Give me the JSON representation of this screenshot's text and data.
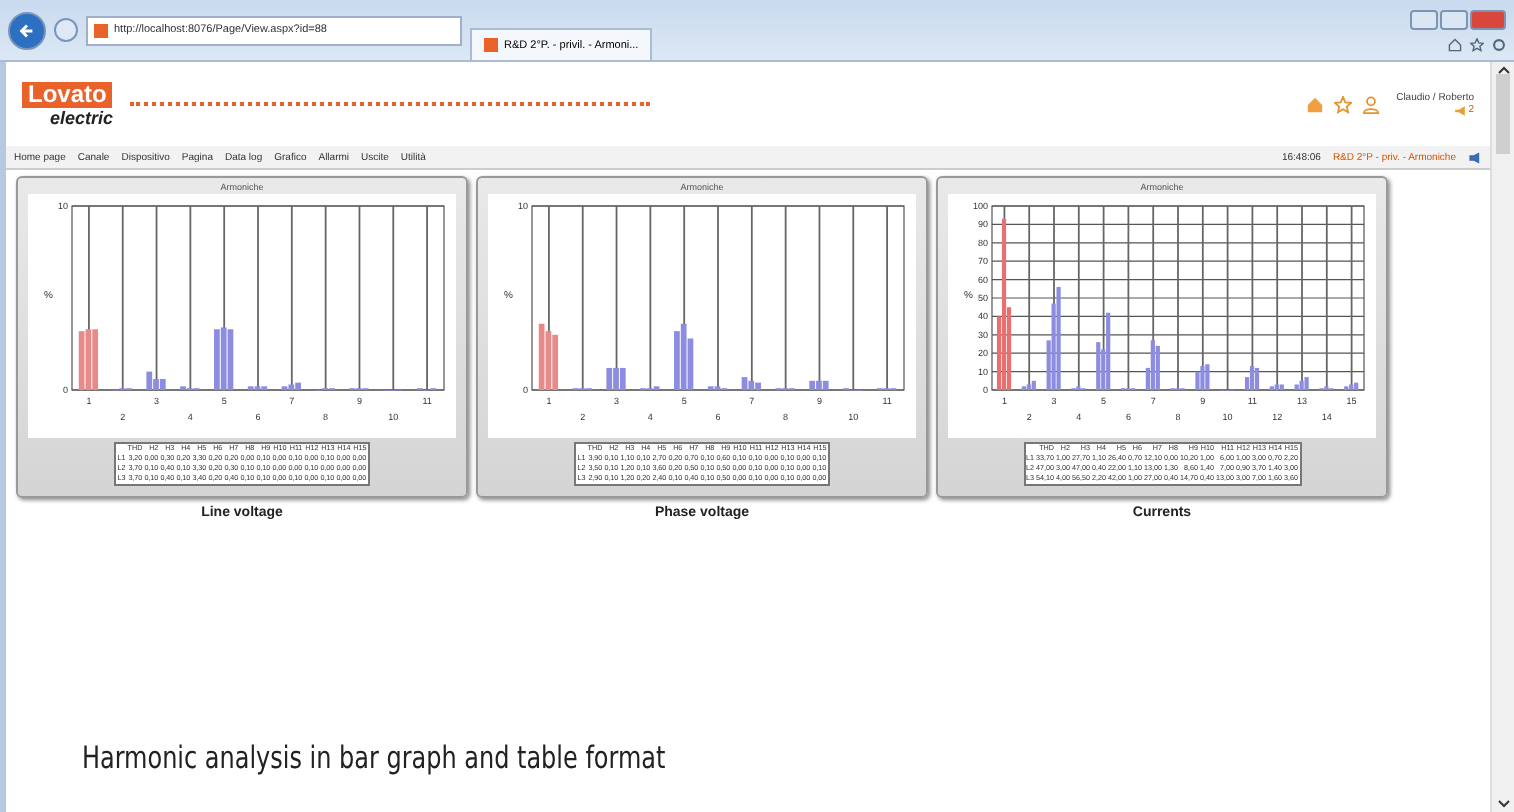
{
  "browser": {
    "address": "http://localhost:8076/Page/View.aspx?id=88",
    "tab_title": "R&D 2°P. - privil. - Armoni..."
  },
  "header": {
    "logo_top": "Lovato",
    "logo_bottom": "electric",
    "user": "Claudio / Roberto",
    "alert_count": "2"
  },
  "menu": {
    "items": [
      "Home page",
      "Canale",
      "Dispositivo",
      "Pagina",
      "Data log",
      "Grafico",
      "Allarmi",
      "Uscite",
      "Utilità"
    ],
    "time": "16:48:06",
    "location": "R&D 2°P - priv. - Armoniche"
  },
  "panels": [
    {
      "caption": "Line voltage",
      "chart_data": {
        "type": "bar",
        "title": "Armoniche",
        "ylabel": "%",
        "grid": true,
        "categories": [
          "1",
          "2",
          "3",
          "4",
          "5",
          "6",
          "7",
          "8",
          "9",
          "10",
          "11"
        ],
        "ylim": [
          0,
          10
        ],
        "yticks": [
          0,
          10
        ],
        "series": [
          {
            "color": "#e88a8a",
            "values": [
              3.2,
              null,
              null,
              null,
              null,
              null,
              null,
              null,
              null,
              null,
              null
            ]
          },
          {
            "color": "#e88a8a",
            "values": [
              3.3,
              null,
              null,
              null,
              null,
              null,
              null,
              null,
              null,
              null,
              null
            ]
          },
          {
            "color": "#e88a8a",
            "values": [
              3.3,
              null,
              null,
              null,
              null,
              null,
              null,
              null,
              null,
              null,
              null
            ]
          },
          {
            "color": "#8c8ce0",
            "values": [
              null,
              0.0,
              1.0,
              0.2,
              3.3,
              0.2,
              0.2,
              0.0,
              0.1,
              0.0,
              0.1
            ]
          },
          {
            "color": "#8c8ce0",
            "values": [
              null,
              0.1,
              0.6,
              0.1,
              3.4,
              0.2,
              0.3,
              0.1,
              0.1,
              0.0,
              0.0
            ]
          },
          {
            "color": "#8c8ce0",
            "values": [
              null,
              0.1,
              0.6,
              0.1,
              3.3,
              0.2,
              0.4,
              0.1,
              0.1,
              0.0,
              0.1
            ]
          }
        ]
      },
      "table": {
        "columns": [
          "THD",
          "H2",
          "H3",
          "H4",
          "H5",
          "H6",
          "H7",
          "H8",
          "H9",
          "H10",
          "H11",
          "H12",
          "H13",
          "H14",
          "H15"
        ],
        "rows": [
          {
            "label": "L1",
            "values": [
              "3,20",
              "0,00",
              "0,30",
              "0,20",
              "3,30",
              "0,20",
              "0,20",
              "0,00",
              "0,10",
              "0,00",
              "0,10",
              "0,00",
              "0,10",
              "0,00",
              "0,00"
            ]
          },
          {
            "label": "L2",
            "values": [
              "3,70",
              "0,10",
              "0,40",
              "0,10",
              "3,30",
              "0,20",
              "0,30",
              "0,10",
              "0,10",
              "0,00",
              "0,00",
              "0,10",
              "0,00",
              "0,00",
              "0,00"
            ]
          },
          {
            "label": "L3",
            "values": [
              "3,70",
              "0,10",
              "0,40",
              "0,10",
              "3,40",
              "0,20",
              "0,40",
              "0,10",
              "0,10",
              "0,00",
              "0,10",
              "0,00",
              "0,10",
              "0,00",
              "0,00"
            ]
          }
        ]
      }
    },
    {
      "caption": "Phase voltage",
      "chart_data": {
        "type": "bar",
        "title": "Armoniche",
        "ylabel": "%",
        "grid": true,
        "categories": [
          "1",
          "2",
          "3",
          "4",
          "5",
          "6",
          "7",
          "8",
          "9",
          "10",
          "11"
        ],
        "ylim": [
          0,
          10
        ],
        "yticks": [
          0,
          10
        ],
        "series": [
          {
            "color": "#e88a8a",
            "values": [
              3.6,
              null,
              null,
              null,
              null,
              null,
              null,
              null,
              null,
              null,
              null
            ]
          },
          {
            "color": "#e88a8a",
            "values": [
              3.2,
              null,
              null,
              null,
              null,
              null,
              null,
              null,
              null,
              null,
              null
            ]
          },
          {
            "color": "#e88a8a",
            "values": [
              3.0,
              null,
              null,
              null,
              null,
              null,
              null,
              null,
              null,
              null,
              null
            ]
          },
          {
            "color": "#8c8ce0",
            "values": [
              null,
              0.1,
              1.2,
              0.1,
              3.2,
              0.2,
              0.7,
              0.1,
              0.5,
              0.1,
              0.1
            ]
          },
          {
            "color": "#8c8ce0",
            "values": [
              null,
              0.1,
              1.2,
              0.1,
              3.6,
              0.2,
              0.5,
              0.1,
              0.5,
              0.0,
              0.1
            ]
          },
          {
            "color": "#8c8ce0",
            "values": [
              null,
              0.1,
              1.2,
              0.2,
              2.8,
              0.1,
              0.4,
              0.1,
              0.5,
              0.0,
              0.1
            ]
          }
        ]
      },
      "table": {
        "columns": [
          "THD",
          "H2",
          "H3",
          "H4",
          "H5",
          "H6",
          "H7",
          "H8",
          "H9",
          "H10",
          "H11",
          "H12",
          "H13",
          "H14",
          "H15"
        ],
        "rows": [
          {
            "label": "L1",
            "values": [
              "3,90",
              "0,10",
              "1,10",
              "0,10",
              "2,70",
              "0,20",
              "0,70",
              "0,10",
              "0,60",
              "0,10",
              "0,10",
              "0,00",
              "0,10",
              "0,00",
              "0,10"
            ]
          },
          {
            "label": "L2",
            "values": [
              "3,50",
              "0,10",
              "1,20",
              "0,10",
              "3,60",
              "0,20",
              "0,50",
              "0,10",
              "0,50",
              "0,00",
              "0,10",
              "0,00",
              "0,10",
              "0,00",
              "0,10"
            ]
          },
          {
            "label": "L3",
            "values": [
              "2,90",
              "0,10",
              "1,20",
              "0,20",
              "2,40",
              "0,10",
              "0,40",
              "0,10",
              "0,50",
              "0,00",
              "0,10",
              "0,00",
              "0,10",
              "0,00",
              "0,00"
            ]
          }
        ]
      }
    },
    {
      "caption": "Currents",
      "chart_data": {
        "type": "bar",
        "title": "Armoniche",
        "ylabel": "%",
        "grid": true,
        "categories": [
          "1",
          "2",
          "3",
          "4",
          "5",
          "6",
          "7",
          "8",
          "9",
          "10",
          "11",
          "12",
          "13",
          "14",
          "15"
        ],
        "ylim": [
          0,
          100
        ],
        "yticks": [
          0,
          10,
          20,
          30,
          40,
          50,
          60,
          70,
          80,
          90,
          100
        ],
        "series": [
          {
            "color": "#e87070",
            "values": [
              40,
              null,
              null,
              null,
              null,
              null,
              null,
              null,
              null,
              null,
              null,
              null,
              null,
              null,
              null
            ]
          },
          {
            "color": "#e87070",
            "values": [
              93,
              null,
              null,
              null,
              null,
              null,
              null,
              null,
              null,
              null,
              null,
              null,
              null,
              null,
              null
            ]
          },
          {
            "color": "#e87070",
            "values": [
              45,
              null,
              null,
              null,
              null,
              null,
              null,
              null,
              null,
              null,
              null,
              null,
              null,
              null,
              null
            ]
          },
          {
            "color": "#8c8ce0",
            "values": [
              null,
              2,
              27,
              1,
              26,
              1,
              12,
              1,
              10,
              0,
              7,
              2,
              3,
              1,
              2
            ]
          },
          {
            "color": "#8c8ce0",
            "values": [
              null,
              3,
              47,
              2,
              22,
              1,
              27,
              1,
              13,
              0,
              13,
              3,
              5,
              2,
              3
            ]
          },
          {
            "color": "#8c8ce0",
            "values": [
              null,
              5,
              56,
              1,
              42,
              1,
              24,
              1,
              14,
              0,
              12,
              3,
              7,
              1,
              4
            ]
          }
        ]
      },
      "table": {
        "columns": [
          "THD",
          "H2",
          "H3",
          "H4",
          "H5",
          "H6",
          "H7",
          "H8",
          "H9",
          "H10",
          "H11",
          "H12",
          "H13",
          "H14",
          "H15"
        ],
        "rows": [
          {
            "label": "L1",
            "values": [
              "33,70",
              "1,00",
              "27,70",
              "1,10",
              "26,40",
              "0,70",
              "12,10",
              "0,00",
              "10,20",
              "1,00",
              "6,00",
              "1,00",
              "3,00",
              "0,70",
              "2,20"
            ]
          },
          {
            "label": "L2",
            "values": [
              "47,00",
              "3,00",
              "47,00",
              "0,40",
              "22,00",
              "1,10",
              "13,00",
              "1,30",
              "8,60",
              "1,40",
              "7,00",
              "0,90",
              "3,70",
              "1,40",
              "3,00"
            ]
          },
          {
            "label": "L3",
            "values": [
              "54,10",
              "4,00",
              "56,50",
              "2,20",
              "42,00",
              "1,00",
              "27,00",
              "0,40",
              "14,70",
              "0,40",
              "13,00",
              "3,00",
              "7,00",
              "1,60",
              "3,60"
            ]
          }
        ]
      }
    }
  ],
  "caption": "Harmonic analysis in bar graph and table format"
}
